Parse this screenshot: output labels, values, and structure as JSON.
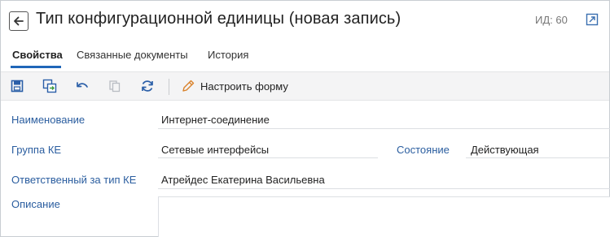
{
  "header": {
    "title": "Тип конфигурационной единицы (новая запись)",
    "id_label": "ИД: 60"
  },
  "tabs": [
    {
      "label": "Свойства",
      "active": true
    },
    {
      "label": "Связанные документы",
      "active": false
    },
    {
      "label": "История",
      "active": false
    }
  ],
  "toolbar": {
    "icons": [
      "save-icon",
      "save-and-new-icon",
      "undo-icon",
      "copy-icon",
      "refresh-icon",
      "pencil-icon"
    ],
    "configure_form_label": "Настроить форму"
  },
  "form": {
    "name": {
      "label": "Наименование",
      "value": "Интернет-соединение"
    },
    "group": {
      "label": "Группа КЕ",
      "value": "Сетевые интерфейсы"
    },
    "state": {
      "label": "Состояние",
      "value": "Действующая"
    },
    "owner": {
      "label": "Ответственный за тип КЕ",
      "value": "Атрейдес Екатерина Васильевна"
    },
    "description": {
      "label": "Описание",
      "value": ""
    }
  },
  "colors": {
    "accent": "#1f66b8",
    "label": "#2a5d9f",
    "toolbar_bg": "#f4f4f5"
  }
}
